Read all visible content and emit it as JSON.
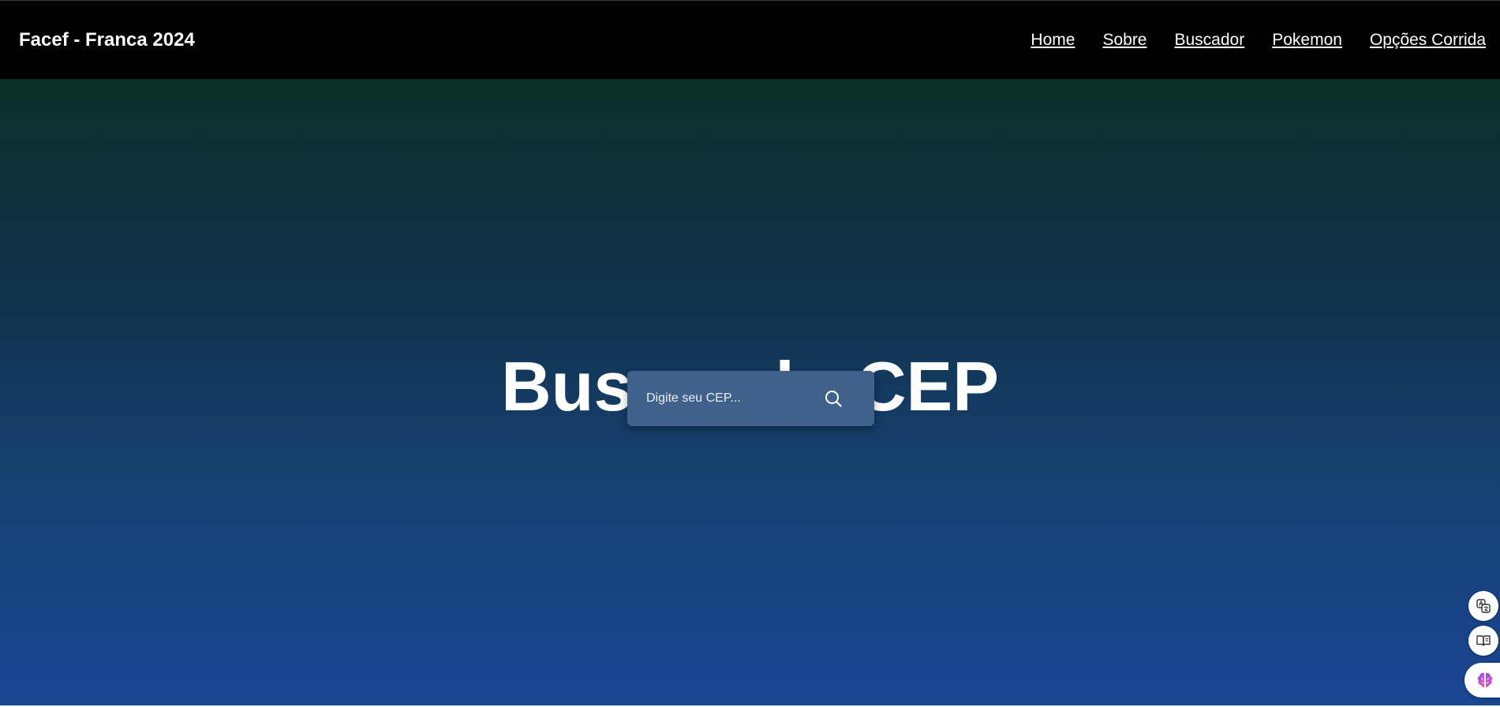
{
  "navbar": {
    "brand": "Facef - Franca 2024",
    "links": [
      {
        "label": "Home"
      },
      {
        "label": "Sobre"
      },
      {
        "label": "Buscador"
      },
      {
        "label": "Pokemon"
      },
      {
        "label": "Opções Corrida"
      }
    ]
  },
  "hero": {
    "title": "Buscando CEP",
    "search": {
      "placeholder": "Digite seu CEP...",
      "value": "",
      "icon": "search-icon"
    }
  },
  "side_tools": {
    "icons": [
      "translate-icon",
      "reader-mode-icon",
      "brain-icon"
    ]
  },
  "colors": {
    "navbar_bg": "#000000",
    "gradient_top": "#0b3128",
    "gradient_bottom": "#1a4795",
    "search_bg": "#40618a",
    "text": "#ffffff"
  }
}
